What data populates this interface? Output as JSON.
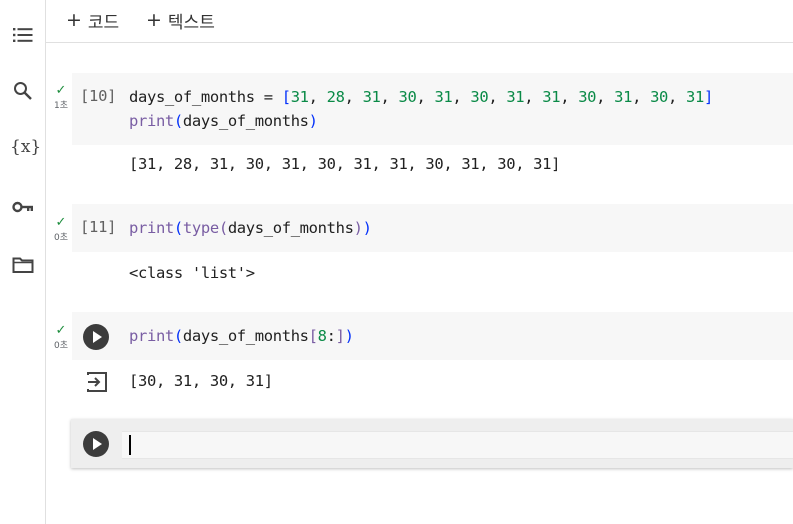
{
  "toolbar": {
    "add_code_label": "코드",
    "add_text_label": "텍스트"
  },
  "sidebar": {
    "items": [
      {
        "icon": "table-of-contents-icon"
      },
      {
        "icon": "search-icon"
      },
      {
        "icon": "variables-icon",
        "glyph": "{x}"
      },
      {
        "icon": "key-icon"
      },
      {
        "icon": "folder-icon"
      }
    ]
  },
  "cells": [
    {
      "exec_count": "[10]",
      "status_time": "1초",
      "code_lines": [
        "days_of_months = [31, 28, 31, 30, 31, 30, 31, 31, 30, 31, 30, 31]",
        "print(days_of_months)"
      ],
      "output": "[31, 28, 31, 30, 31, 30, 31, 31, 30, 31, 30, 31]"
    },
    {
      "exec_count": "[11]",
      "status_time": "0초",
      "code_lines": [
        "print(type(days_of_months))"
      ],
      "output": "<class 'list'>"
    },
    {
      "exec_count": "",
      "status_time": "0초",
      "code_lines": [
        "print(days_of_months[8:])"
      ],
      "output": "[30, 31, 30, 31]"
    },
    {
      "code_lines": [
        ""
      ]
    }
  ],
  "colors": {
    "number": "#0a8a47",
    "function": "#795da3",
    "bracket": "#0431fa",
    "check": "#1e8e3e",
    "code_bg": "#f7f7f7"
  }
}
